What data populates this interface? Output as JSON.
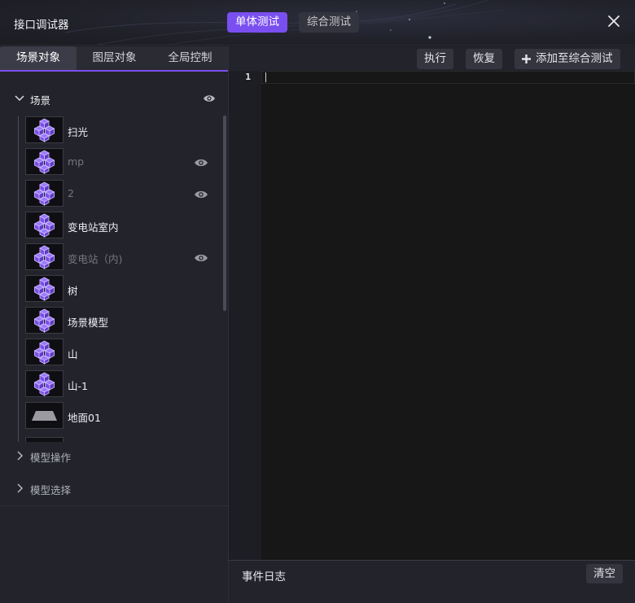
{
  "window": {
    "title": "接口调试器",
    "close_icon": "close-icon"
  },
  "mode_tabs": [
    {
      "label": "单体测试",
      "active": true
    },
    {
      "label": "综合测试",
      "active": false
    }
  ],
  "left_tabs": [
    {
      "label": "场景对象",
      "active": true
    },
    {
      "label": "图层对象",
      "active": false
    },
    {
      "label": "全局控制",
      "active": false
    }
  ],
  "scene_section": {
    "label": "场景",
    "expanded": true,
    "items": [
      {
        "name": "扫光",
        "thumb": "cube-cluster-icon",
        "dim": false,
        "eye": false
      },
      {
        "name": "mp",
        "thumb": "cube-cluster-icon",
        "dim": true,
        "eye": true
      },
      {
        "name": "2",
        "thumb": "cube-cluster-icon",
        "dim": true,
        "eye": true
      },
      {
        "name": "变电站室内",
        "thumb": "cube-cluster-icon",
        "dim": false,
        "eye": false
      },
      {
        "name": "变电站（内)",
        "thumb": "cube-cluster-icon",
        "dim": true,
        "eye": true
      },
      {
        "name": "树",
        "thumb": "cube-cluster-icon",
        "dim": false,
        "eye": false
      },
      {
        "name": "场景模型",
        "thumb": "cube-cluster-icon",
        "dim": false,
        "eye": false
      },
      {
        "name": "山",
        "thumb": "cube-cluster-icon",
        "dim": false,
        "eye": false
      },
      {
        "name": "山-1",
        "thumb": "cube-cluster-icon",
        "dim": false,
        "eye": false
      },
      {
        "name": "地面01",
        "thumb": "ground-plane-icon",
        "dim": false,
        "eye": false
      }
    ]
  },
  "collapsed_sections": [
    {
      "label": "模型操作"
    },
    {
      "label": "模型选择"
    }
  ],
  "toolbar": {
    "run_label": "执行",
    "restore_label": "恢复",
    "add_label": "添加至综合测试"
  },
  "editor": {
    "line_numbers": [
      "1"
    ]
  },
  "log": {
    "title": "事件日志",
    "clear_label": "清空"
  },
  "colors": {
    "accent": "#7a4ff0",
    "cube": "#7b4fe6",
    "background": "#1e1f25",
    "editor_bg": "#171717"
  }
}
